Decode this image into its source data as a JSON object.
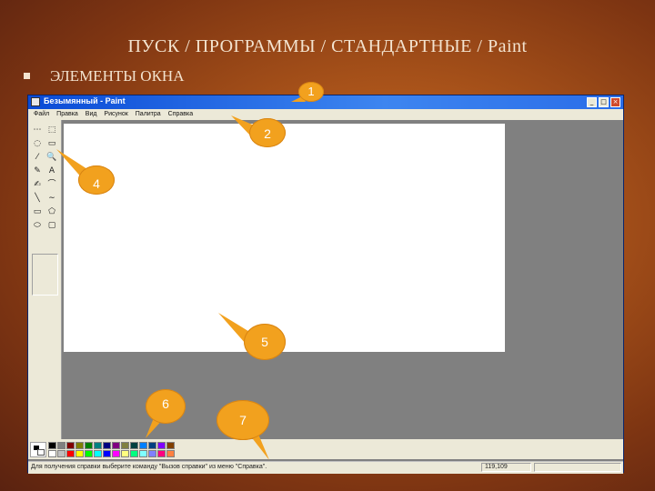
{
  "slide": {
    "title": "ПУСК / ПРОГРАММЫ / СТАНДАРТНЫЕ /  Paint",
    "bullet": "ЭЛЕМЕНТЫ ОКНА"
  },
  "window": {
    "title": "Безымянный - Paint",
    "buttons": {
      "minimize": "_",
      "maximize": "□",
      "close": "×"
    },
    "menu": [
      "Файл",
      "Правка",
      "Вид",
      "Рисунок",
      "Палитра",
      "Справка"
    ],
    "tools": [
      "⋯",
      "⬚",
      "◌",
      "▭",
      "⁄",
      "🔍",
      "✎",
      "A",
      "✍",
      "⌒",
      "╲",
      "∼",
      "▭",
      "⬠",
      "⬭",
      "▢"
    ],
    "status_text": "Для получения справки выберите команду \"Вызов справки\" из меню \"Справка\".",
    "status_coords": "119,109"
  },
  "palette": {
    "foreground": "#000000",
    "background": "#ffffff",
    "row1": [
      "#000000",
      "#808080",
      "#800000",
      "#808000",
      "#008000",
      "#008080",
      "#000080",
      "#800080",
      "#808040",
      "#004040",
      "#0080ff",
      "#004080",
      "#8000ff",
      "#804000"
    ],
    "row2": [
      "#ffffff",
      "#c0c0c0",
      "#ff0000",
      "#ffff00",
      "#00ff00",
      "#00ffff",
      "#0000ff",
      "#ff00ff",
      "#ffff80",
      "#00ff80",
      "#80ffff",
      "#8080ff",
      "#ff0080",
      "#ff8040"
    ]
  },
  "callouts": [
    "1",
    "2",
    "4",
    "5",
    "6",
    "7"
  ],
  "colors": {
    "accent": "#f2a11e",
    "titlebar": "#0a4bd6",
    "workspace": "#808080"
  }
}
